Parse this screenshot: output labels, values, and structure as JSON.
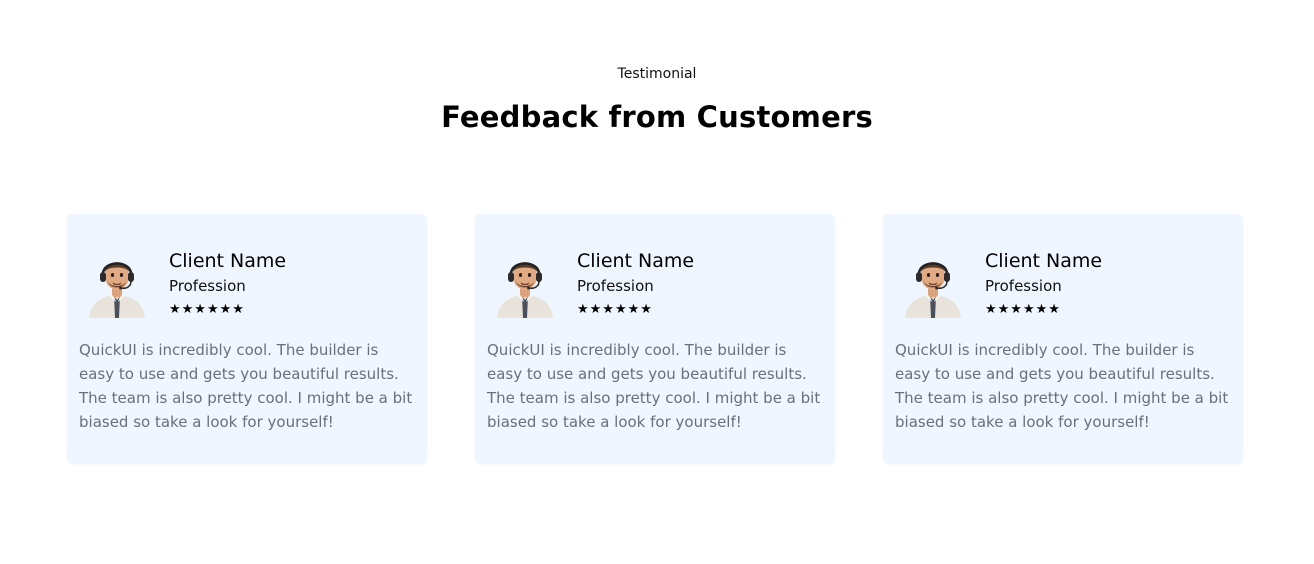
{
  "section": {
    "eyebrow": "Testimonial",
    "headline": "Feedback from Customers"
  },
  "testimonials": [
    {
      "avatar_icon": "avatar-headset-icon",
      "client_name": "Client Name",
      "profession": "Profession",
      "stars": "★★★★★★",
      "quote": "QuickUI is incredibly cool. The builder is easy to use and gets you beautiful results. The team is also pretty cool. I might be a bit biased so take a look for yourself!"
    },
    {
      "avatar_icon": "avatar-headset-icon",
      "client_name": "Client Name",
      "profession": "Profession",
      "stars": "★★★★★★",
      "quote": "QuickUI is incredibly cool. The builder is easy to use and gets you beautiful results. The team is also pretty cool. I might be a bit biased so take a look for yourself!"
    },
    {
      "avatar_icon": "avatar-headset-icon",
      "client_name": "Client Name",
      "profession": "Profession",
      "stars": "★★★★★★",
      "quote": "QuickUI is incredibly cool. The builder is easy to use and gets you beautiful results. The team is also pretty cool. I might be a bit biased so take a look for yourself!"
    }
  ],
  "colors": {
    "card_background": "#eff6ff",
    "quote_text": "#6b6f7a",
    "heading_text": "#000000"
  }
}
